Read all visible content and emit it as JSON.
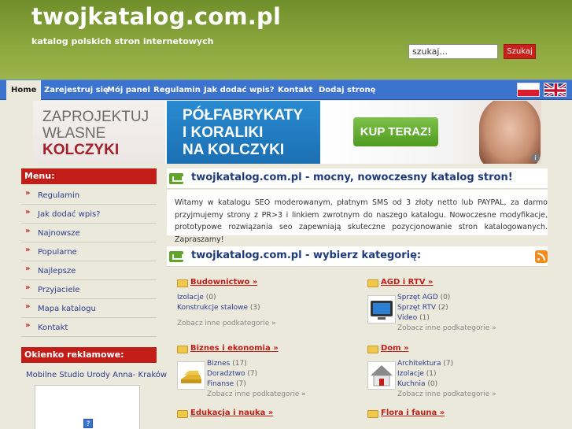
{
  "header": {
    "title": "twojkatalog.com.pl",
    "subtitle": "katalog polskich stron internetowych",
    "search_value": "szukaj...",
    "search_button": "Szukaj",
    "colors": {
      "header_green": "#86a33a",
      "nav_blue": "#3b73cf",
      "accent_red": "#c21d16"
    }
  },
  "nav": {
    "items": [
      {
        "label": "Home"
      },
      {
        "label": "Zarejestruj się"
      },
      {
        "label": "Mój panel"
      },
      {
        "label": "Regulamin"
      },
      {
        "label": "Jak dodać wpis?"
      },
      {
        "label": "Kontakt"
      },
      {
        "label": "Dodaj stronę"
      }
    ],
    "flags": [
      "polish-flag-icon",
      "uk-flag-icon"
    ]
  },
  "banner": {
    "left_lines": [
      "ZAPROJEKTUJ",
      "WŁASNE",
      "KOLCZYKI"
    ],
    "middle_lines": [
      "PÓŁFABRYKATY",
      "I KORALIKI",
      "NA KOLCZYKI"
    ],
    "cta": "KUP TERAZ!",
    "info": "i"
  },
  "sidebar": {
    "menu_title": "Menu:",
    "menu_items": [
      {
        "label": "Regulamin"
      },
      {
        "label": "Jak dodać wpis?"
      },
      {
        "label": "Najnowsze"
      },
      {
        "label": "Popularne"
      },
      {
        "label": "Najlepsze"
      },
      {
        "label": "Przyjaciele"
      },
      {
        "label": "Mapa katalogu"
      },
      {
        "label": "Kontakt"
      }
    ],
    "ad_title": "Okienko reklamowe:",
    "ad_text": "Mobilne Studio Urody Anna- Kraków",
    "ad_icon": "?"
  },
  "main": {
    "intro_title": "twojkatalog.com.pl - mocny, nowoczesny katalog stron!",
    "intro_text": "Witamy w katalogu SEO moderowanym, płatnym SMS od 3 złoty netto lub PAYPAL, za darmo przyjmujemy strony z PR>3 i linkiem zwrotnym do naszego katalogu. Nowoczesne modyfikacje, prototypowe rozwiązania seo zapewniają skuteczne pozycjonowanie stron katalogowanych. Zapraszamy!",
    "cats_title": "twojkatalog.com.pl - wybierz kategorię:",
    "more_label": "Zobacz inne podkategorie »",
    "categories": [
      {
        "name": "Budownictwo »",
        "subs": [
          {
            "label": "Izolacje",
            "count": "(0)"
          },
          {
            "label": "Konstrukcje stalowe",
            "count": "(3)"
          }
        ]
      },
      {
        "name": "AGD i RTV »",
        "subs": [
          {
            "label": "Sprzęt AGD",
            "count": "(0)"
          },
          {
            "label": "Sprzęt RTV",
            "count": "(2)"
          },
          {
            "label": "Video",
            "count": "(1)"
          }
        ]
      },
      {
        "name": "Biznes i ekonomia »",
        "subs": [
          {
            "label": "Biznes",
            "count": "(17)"
          },
          {
            "label": "Doradztwo",
            "count": "(7)"
          },
          {
            "label": "Finanse",
            "count": "(7)"
          }
        ]
      },
      {
        "name": "Dom »",
        "subs": [
          {
            "label": "Architektura",
            "count": "(7)"
          },
          {
            "label": "Izolacje",
            "count": "(1)"
          },
          {
            "label": "Kuchnia",
            "count": "(0)"
          }
        ]
      },
      {
        "name": "Edukacja i nauka »",
        "subs": []
      },
      {
        "name": "Flora i fauna »",
        "subs": []
      }
    ]
  }
}
